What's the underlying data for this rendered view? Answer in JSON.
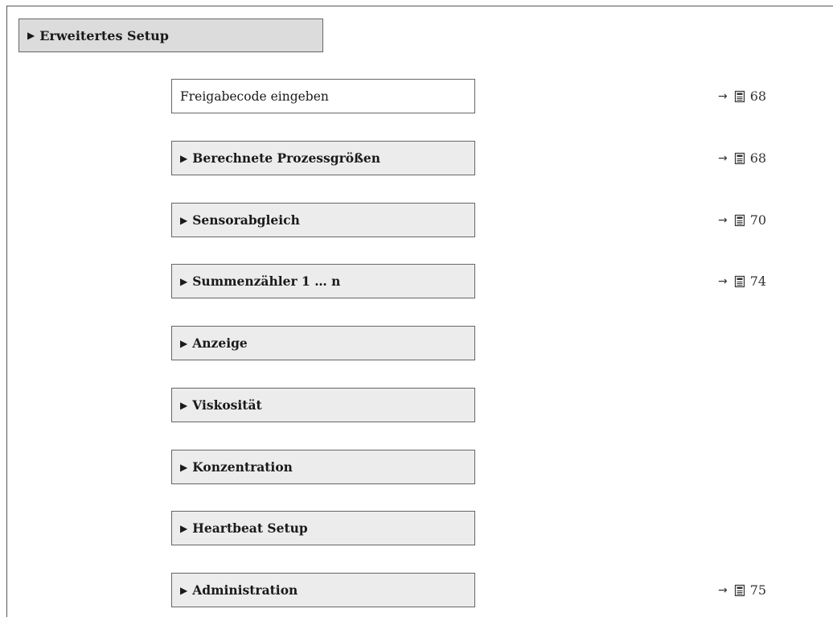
{
  "header": {
    "label": "Erweitertes Setup"
  },
  "items": [
    {
      "label": "Freigabecode eingeben",
      "kind": "param",
      "ref": "68"
    },
    {
      "label": "Berechnete Prozessgrößen",
      "kind": "submenu",
      "ref": "68"
    },
    {
      "label": "Sensorabgleich",
      "kind": "submenu",
      "ref": "70"
    },
    {
      "label": "Summenzähler 1 … n",
      "kind": "submenu",
      "ref": "74"
    },
    {
      "label": "Anzeige",
      "kind": "submenu",
      "ref": ""
    },
    {
      "label": "Viskosität",
      "kind": "submenu",
      "ref": ""
    },
    {
      "label": "Konzentration",
      "kind": "submenu",
      "ref": ""
    },
    {
      "label": "Heartbeat Setup",
      "kind": "submenu",
      "ref": ""
    },
    {
      "label": "Administration",
      "kind": "submenu",
      "ref": "75"
    }
  ],
  "icons": {
    "submenu_marker": "triangle-right-icon",
    "ref_arrow": "arrow-right-icon",
    "ref_page": "page-book-icon"
  },
  "colors": {
    "header_bg": "#dcdcdc",
    "submenu_bg": "#ececec",
    "param_bg": "#ffffff",
    "border": "#666666"
  }
}
